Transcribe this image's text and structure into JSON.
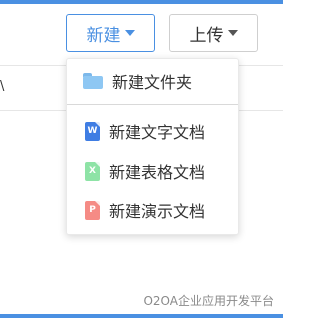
{
  "toolbar": {
    "new_label": "新建",
    "upload_label": "上传"
  },
  "list": {
    "partial_char": "\\"
  },
  "new_menu": {
    "items": [
      {
        "label": "新建文件夹",
        "icon": "folder-icon"
      },
      {
        "label": "新建文字文档",
        "icon": "word-doc-icon",
        "badge": "W"
      },
      {
        "label": "新建表格文档",
        "icon": "excel-doc-icon",
        "badge": "X"
      },
      {
        "label": "新建演示文档",
        "icon": "ppt-doc-icon",
        "badge": "P"
      }
    ]
  },
  "footer": {
    "watermark": "O2OA企业应用开发平台"
  },
  "colors": {
    "accent": "#4a90e2",
    "word": "#3f7de3",
    "excel": "#8ee3a6",
    "ppt": "#f58b85",
    "folder": "#8ec7f3"
  }
}
